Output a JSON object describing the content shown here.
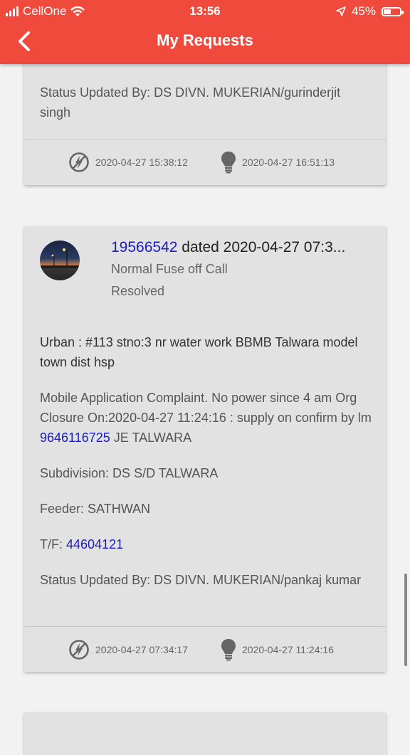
{
  "status_bar": {
    "carrier": "CellOne",
    "time": "13:56",
    "battery_percent": "45%",
    "battery_level": 0.45
  },
  "header": {
    "title": "My Requests"
  },
  "cards": [
    {
      "status_updated": "Status Updated By: DS DIVN. MUKERIAN/gurinderjit singh",
      "lodged_time": "2020-04-27 15:38:12",
      "resolved_time": "2020-04-27 16:51:13"
    },
    {
      "request_no": "19566542",
      "dated": "dated 2020-04-27 07:3...",
      "type": "Normal Fuse off Call",
      "status": "Resolved",
      "address": "Urban : #113 stno:3 nr water work BBMB Talwara model town dist hsp",
      "remarks_pre": "Mobile Application Complaint. No power since 4 am Org Closure On:2020-04-27 11:24:16 : supply on confirm by lm ",
      "remarks_phone": "9646116725",
      "remarks_post": " JE TALWARA",
      "subdivision": "Subdivision: DS S/D TALWARA",
      "feeder": "Feeder: SATHWAN",
      "tf_label": "T/F: ",
      "tf_value": "44604121",
      "status_updated": "Status Updated By: DS DIVN. MUKERIAN/pankaj kumar",
      "lodged_time": "2020-04-27 07:34:17",
      "resolved_time": "2020-04-27 11:24:16"
    }
  ],
  "icons": {
    "lodged": "no-power-icon",
    "resolved": "bulb-icon",
    "back": "chevron-left-icon"
  },
  "colors": {
    "header": "#ef4a3c",
    "card": "#e2e2e2",
    "link": "#1a1ac8"
  }
}
